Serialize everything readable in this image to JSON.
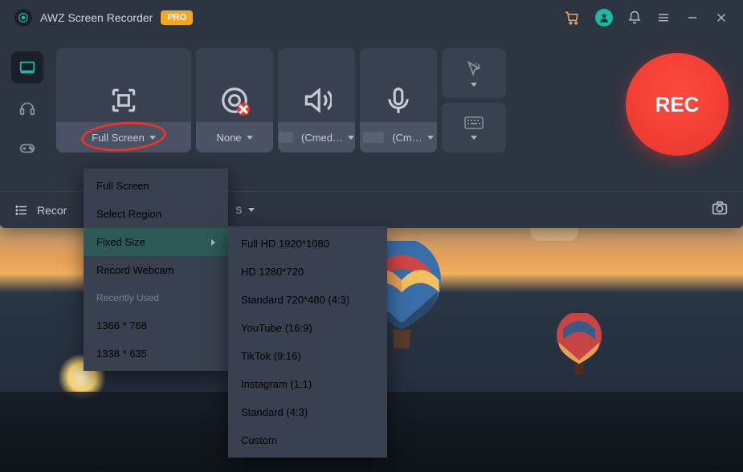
{
  "app": {
    "title": "AWZ Screen Recorder",
    "badge": "PRO"
  },
  "rec_label": "REC",
  "panels": {
    "region": {
      "label": "Full Screen"
    },
    "webcam": {
      "label": "None"
    },
    "speaker": {
      "label": "(Cmed…"
    },
    "mic": {
      "label": "(Cm…"
    }
  },
  "bottom": {
    "left_label": "Recor"
  },
  "menu": {
    "items": [
      "Full Screen",
      "Select Region",
      "Fixed Size",
      "Record Webcam"
    ],
    "recent_label": "Recently Used",
    "recent": [
      "1366 * 768",
      "1338 * 635"
    ]
  },
  "submenu": [
    "Full HD 1920*1080",
    "HD 1280*720",
    "Standard 720*480 (4:3)",
    "YouTube (16:9)",
    "TikTok (9:16)",
    "Instagram (1:1)",
    "Standard (4:3)",
    "Custom"
  ]
}
